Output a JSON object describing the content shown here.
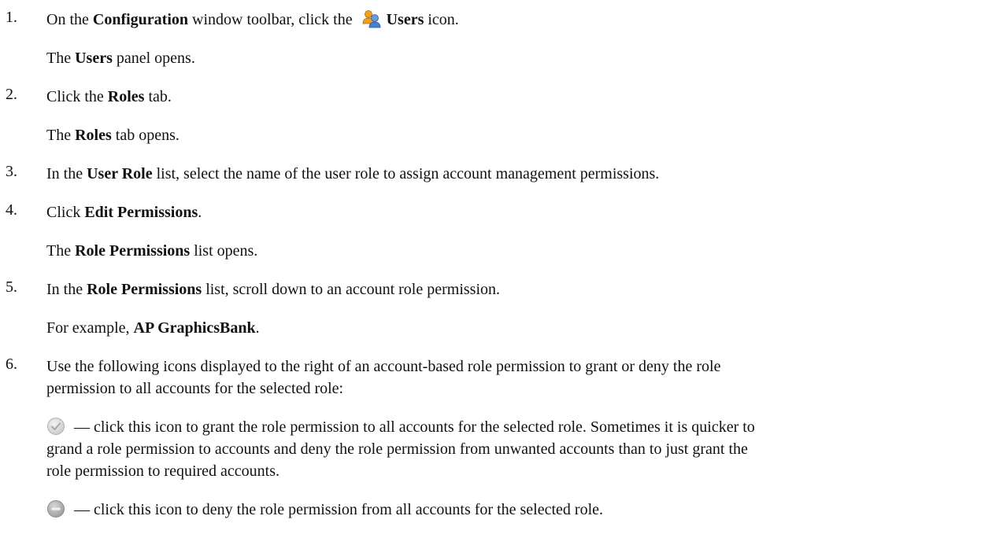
{
  "steps": [
    {
      "num": "1.",
      "pre": "On the ",
      "bold1": "Configuration",
      "mid": " window toolbar, click the ",
      "bold2": "Users",
      "post": " icon.",
      "result_pre": "The ",
      "result_bold": "Users",
      "result_post": " panel opens."
    },
    {
      "num": "2.",
      "pre": "Click the ",
      "bold1": "Roles",
      "post": " tab.",
      "result_pre": "The ",
      "result_bold": "Roles",
      "result_post": " tab opens."
    },
    {
      "num": "3.",
      "pre": "In the ",
      "bold1": "User Role",
      "post": " list, select the name of the user role to assign account management permissions."
    },
    {
      "num": "4.",
      "pre": "Click ",
      "bold1": "Edit Permissions",
      "post": ".",
      "result_pre": "The ",
      "result_bold": "Role Permissions",
      "result_post": " list opens."
    },
    {
      "num": "5.",
      "pre": "In the ",
      "bold1": "Role Permissions",
      "post": " list, scroll down to an account role permission.",
      "result_pre": "For example, ",
      "result_bold": "AP GraphicsBank",
      "result_post": "."
    },
    {
      "num": "6.",
      "line1": "Use the following icons displayed to the right of an account-based role permission to grant or deny the role",
      "line2": "permission to all accounts for the selected role:",
      "grant_line1": " — click this icon to grant the role permission to all accounts for the selected role. Sometimes it is quicker to",
      "grant_line2": "grand a role permission to accounts and deny the role permission from unwanted accounts than to just grant the",
      "grant_line3": "role permission to required accounts.",
      "deny_text": " — click this icon to deny the role permission from all accounts for the selected role."
    }
  ],
  "icons": {
    "users": "users-icon",
    "grant_all": "check-circle-icon",
    "deny_all": "minus-circle-icon"
  },
  "colors": {
    "users_orange": "#f0a020",
    "users_blue": "#4a7fc8",
    "grant_grey": "#c8c8c8",
    "deny_grey": "#9a9a9a"
  }
}
